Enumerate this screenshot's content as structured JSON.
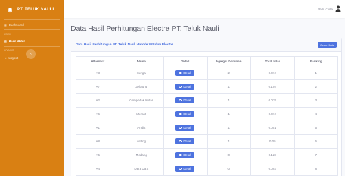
{
  "sidebar": {
    "brand": "PT. TELUK NAULI",
    "items": [
      {
        "label": "Dashboard"
      },
      {
        "label": "Hasil Akhir"
      },
      {
        "label": "Logout"
      }
    ],
    "headings": [
      "USER",
      "LOGOUT"
    ]
  },
  "topbar": {
    "user_name": "Bella Cinta"
  },
  "page": {
    "title": "Data Hasil Perhitungan Electre PT. Teluk Nauli"
  },
  "card": {
    "title": "Data Hasil Perhitungan PT. Teluk Nauli Metode WP dan Electre",
    "print_label": "Cetak Data"
  },
  "table": {
    "headers": [
      "Alternatif",
      "Nama",
      "Detail",
      "Agregat Dominan",
      "Total Nilai",
      "Ranking"
    ],
    "detail_label": "Detail",
    "rows": [
      {
        "alt": "A3",
        "nama": "Cengal",
        "agregat": "2",
        "total": "0.074",
        "rank": "1"
      },
      {
        "alt": "A7",
        "nama": "Jelutung",
        "agregat": "1",
        "total": "0.104",
        "rank": "2"
      },
      {
        "alt": "A2",
        "nama": "Cempedak Hutan",
        "agregat": "1",
        "total": "0.075",
        "rank": "3"
      },
      {
        "alt": "A6",
        "nama": "Meranti",
        "agregat": "1",
        "total": "0.074",
        "rank": "4"
      },
      {
        "alt": "A1",
        "nama": "Andis",
        "agregat": "1",
        "total": "0.051",
        "rank": "5"
      },
      {
        "alt": "A8",
        "nama": "Hiding",
        "agregat": "1",
        "total": "0.05",
        "rank": "6"
      },
      {
        "alt": "A5",
        "nama": "Medang",
        "agregat": "0",
        "total": "0.128",
        "rank": "7"
      },
      {
        "alt": "A4",
        "nama": "Dara Dara",
        "agregat": "0",
        "total": "0.093",
        "rank": "8"
      }
    ]
  },
  "colors": {
    "sidebar": "#d98013",
    "primary": "#4e73df"
  }
}
